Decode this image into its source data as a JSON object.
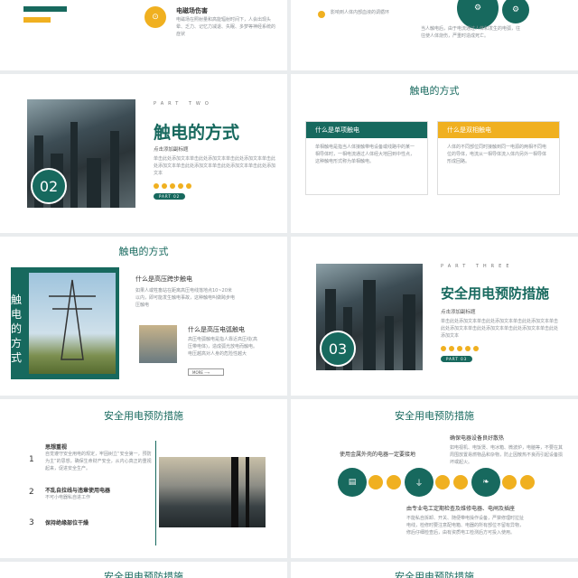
{
  "slide1": {
    "item_title": "电磁场伤害",
    "item_desc": "电磁场在照射量和高能辐射时间下，人会出现头晕、乏力、记忆力减退、失眠、多梦等神经系统的症状",
    "right_text1": "影响到人体内部血液的调循环",
    "right_text2": "当人触电后，由于电流通过人体和发生的电弧，往往使人体烧伤，严重时造成死亡。"
  },
  "slide2": {
    "part_label": "PART TWO",
    "title": "触电的方式",
    "subtitle": "点击添加副标题",
    "desc": "单击此处添加文本单击此处添加文本单击此处添加文本单击此处添加文本单击此处添加文本单击此处添加文本单击此处添加文本",
    "number": "02",
    "pill": "PART 02"
  },
  "slide3": {
    "title": "触电的方式",
    "card1_title": "什么是单项触电",
    "card1_text": "单相触电是指当人体接触带电设备或线路中的某一相导体时，一相电流通过人体经大地回到中性点，这种触电形式称为单相触电。",
    "card2_title": "什么是双相触电",
    "card2_text": "人体的不同部位同时接触到同一电源的两相不同电位的导体，电流从一相导体流入体内另外一相导体形成回路。"
  },
  "slide4": {
    "title": "触电的方式",
    "side_label": "触电的方式",
    "item1_title": "什么是高压跨步触电",
    "item1_text": "如果人或牲畜站在距离高压电线落地点10~20米以内，即可能发生触电事故，这种触电叫做跨步电压触电",
    "item2_title": "什么是高压电弧触电",
    "item2_text": "高压电弧触电是指人靠近高压线(高压带电体)，造成弧光放电而触电。电压越高对人身的危险性越大",
    "more": "MORE"
  },
  "slide5": {
    "part_label": "PART THREE",
    "title": "安全用电预防措施",
    "subtitle": "点击添加副标题",
    "desc": "单击此处添加文本单击此处添加文本单击此处添加文本单击此处添加文本单击此处添加文本单击此处添加文本单击此处添加文本",
    "number": "03",
    "pill": "PART 03"
  },
  "slide6": {
    "title": "安全用电预防措施",
    "items": [
      {
        "num": "1",
        "title": "思想重视",
        "text": "自觉遵守安全用电的规定，牢固树立“安全第一，预防为主”的思想，确保生命财产安全，从内心真正的重视起来，促进安全生产。"
      },
      {
        "num": "2",
        "title": "不乱自拉线与违章使用电器",
        "text": "不可小电器私自进工作"
      },
      {
        "num": "3",
        "title": "保持绝缘部位干燥",
        "text": ""
      }
    ]
  },
  "slide7": {
    "title": "安全用电预防措施",
    "top_title": "确保电器设备良好散热",
    "top_text": "如电视机、电饭煲、电冰箱、微波炉，电脑等，不要在其周围放置易燃物品和杂物，防止因散热不良而引起设备损坏或起火。",
    "left_title": "使用金属外壳的电器一定要接地",
    "bottom_title": "由专业电工定期检查及维修电器、电闸及插座",
    "bottom_text": "不能私自拆卸、开关、随便带电操作设备，严禁修理时拉扯电线，检修时要注意配电箱、电器的所有部位不留有异物，修后仔细检查后，由有资质电工检测后方可投入使用。",
    "icon1": "book-icon",
    "icon2": "plug-icon",
    "icon3": "leaf-icon"
  },
  "slide8": {
    "title": "安全用电预防措施"
  },
  "slide9": {
    "title": "安全用电预防措施"
  },
  "colors": {
    "teal": "#17695e",
    "yellow": "#f0b020"
  }
}
